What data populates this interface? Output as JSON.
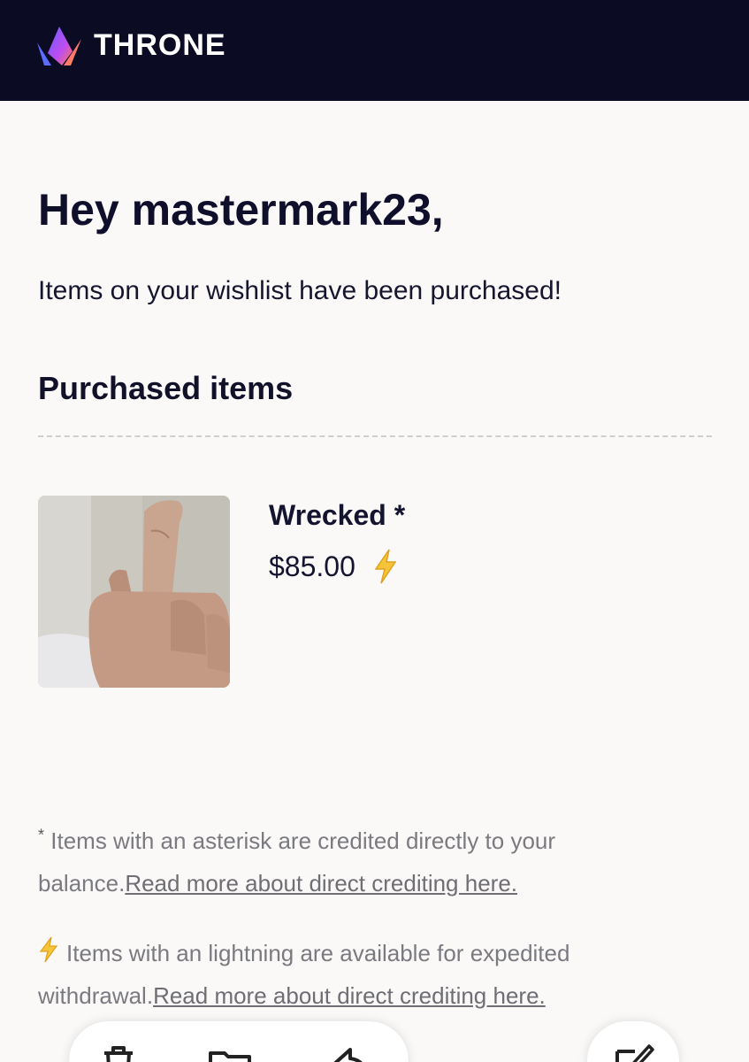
{
  "header": {
    "brand": "THRONE",
    "logo_icon": "crown-logo-icon",
    "background": "#0c0b24"
  },
  "email": {
    "greeting": "Hey mastermark23,",
    "subtitle": "Items on your wishlist have been purchased!",
    "section_title": "Purchased items",
    "items": [
      {
        "name": "Wrecked *",
        "price": "$85.00",
        "badge_icon": "lightning-icon",
        "image_icon": "hand-gesture-photo"
      }
    ],
    "notes": {
      "asterisk_symbol": "*",
      "asterisk_text": "Items with an asterisk are credited directly to your balance.",
      "asterisk_link": "Read more about direct crediting here.",
      "lightning_text": "Items with an lightning are available for expedited withdrawal.",
      "lightning_link": "Read more about direct crediting here."
    }
  },
  "toolbar": {
    "icons": [
      "trash-icon",
      "folder-icon",
      "reply-icon",
      "compose-icon"
    ]
  },
  "colors": {
    "accent_bolt": "#f2b82a",
    "text_dark": "#10102a",
    "muted": "#7a7a80"
  }
}
